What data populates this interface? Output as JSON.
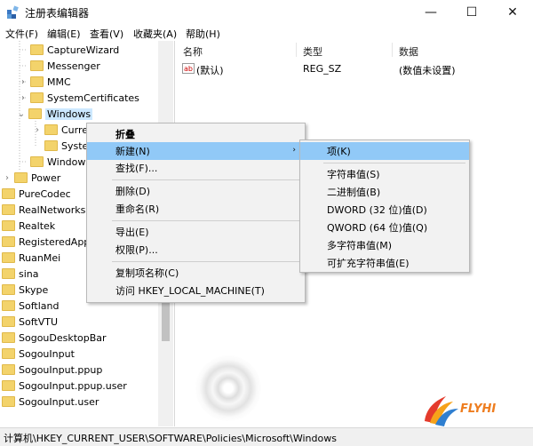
{
  "window": {
    "title": "注册表编辑器",
    "minimize": "—",
    "maximize": "☐",
    "close": "✕"
  },
  "menubar": [
    "文件(F)",
    "编辑(E)",
    "查看(V)",
    "收藏夹(A)",
    "帮助(H)"
  ],
  "tree": [
    {
      "label": "CaptureWizard"
    },
    {
      "label": "Messenger"
    },
    {
      "label": "MMC"
    },
    {
      "label": "SystemCertificates"
    },
    {
      "label": "Windows"
    },
    {
      "label": "Curre"
    },
    {
      "label": "Syster"
    },
    {
      "label": "Windows"
    },
    {
      "label": "Power"
    },
    {
      "label": "PureCodec"
    },
    {
      "label": "RealNetworks"
    },
    {
      "label": "Realtek"
    },
    {
      "label": "RegisteredAppl"
    },
    {
      "label": "RuanMei"
    },
    {
      "label": "sina"
    },
    {
      "label": "Skype"
    },
    {
      "label": "Softland"
    },
    {
      "label": "SoftVTU"
    },
    {
      "label": "SogouDesktopBar"
    },
    {
      "label": "SogouInput"
    },
    {
      "label": "SogouInput.ppup"
    },
    {
      "label": "SogouInput.ppup.user"
    },
    {
      "label": "SogouInput.user"
    }
  ],
  "columns": {
    "name": "名称",
    "type": "类型",
    "data": "数据"
  },
  "values": [
    {
      "icon": "ab",
      "name": "(默认)",
      "type": "REG_SZ",
      "data": "(数值未设置)"
    }
  ],
  "context_menu": {
    "items": [
      "折叠",
      "新建(N)",
      "查找(F)...",
      "删除(D)",
      "重命名(R)",
      "导出(E)",
      "权限(P)...",
      "复制项名称(C)",
      "访问 HKEY_LOCAL_MACHINE(T)"
    ]
  },
  "submenu": {
    "items": [
      "项(K)",
      "字符串值(S)",
      "二进制值(B)",
      "DWORD (32 位)值(D)",
      "QWORD (64 位)值(Q)",
      "多字符串值(M)",
      "可扩充字符串值(E)"
    ]
  },
  "statusbar": {
    "path": "计算机\\HKEY_CURRENT_USER\\SOFTWARE\\Policies\\Microsoft\\Windows"
  },
  "watermark": {
    "text": "FLYHI"
  },
  "colors": {
    "highlight": "#91c9f7",
    "folder": "#f3d36b",
    "menu_bg": "#f2f2f2"
  }
}
